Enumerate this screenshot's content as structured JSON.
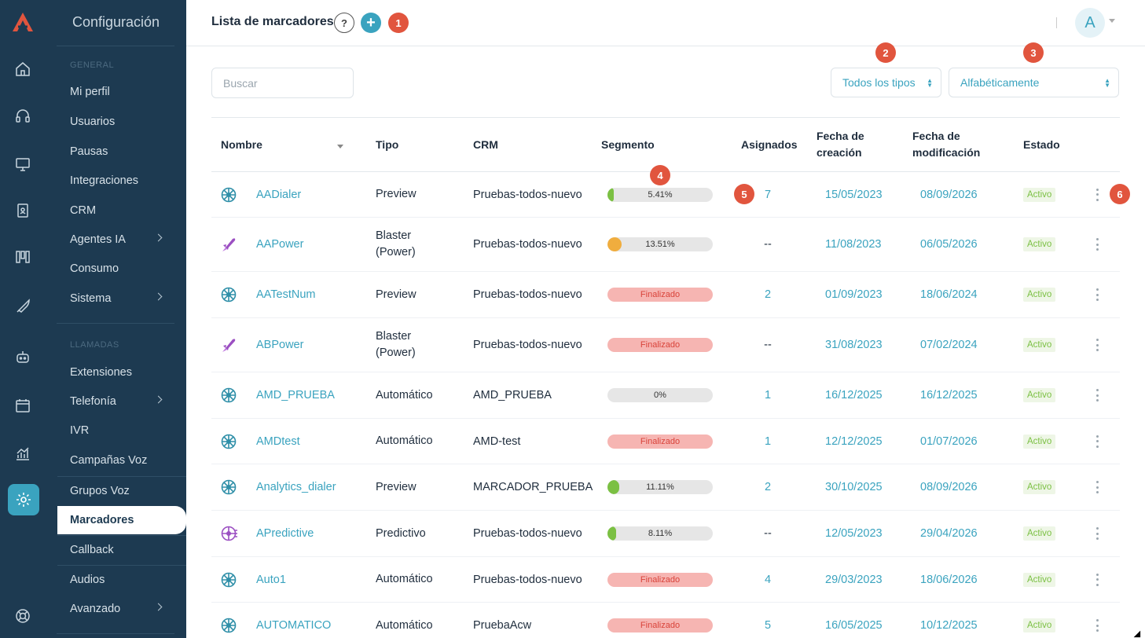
{
  "nav": {
    "title": "Configuración",
    "sections": {
      "general": "GENERAL",
      "calls": "LLAMADAS"
    },
    "items": [
      {
        "label": "Mi perfil"
      },
      {
        "label": "Usuarios"
      },
      {
        "label": "Pausas"
      },
      {
        "label": "Integraciones"
      },
      {
        "label": "CRM"
      },
      {
        "label": "Agentes IA"
      },
      {
        "label": "Consumo"
      },
      {
        "label": "Sistema"
      },
      {
        "label": "Extensiones"
      },
      {
        "label": "Telefonía"
      },
      {
        "label": "IVR"
      },
      {
        "label": "Campañas Voz"
      },
      {
        "label": "Grupos Voz"
      },
      {
        "label": "Marcadores"
      },
      {
        "label": "Callback"
      },
      {
        "label": "Audios"
      },
      {
        "label": "Avanzado"
      }
    ]
  },
  "header": {
    "title": "Lista de marcadores",
    "help": "?",
    "add": "+",
    "avatar": "A"
  },
  "tour_badges": [
    "1",
    "2",
    "3",
    "4",
    "5",
    "6"
  ],
  "filters": {
    "search_placeholder": "Buscar",
    "type": "Todos los tipos",
    "sort": "Alfabéticamente"
  },
  "table": {
    "headers": {
      "name": "Nombre",
      "type": "Tipo",
      "crm": "CRM",
      "segment": "Segmento",
      "assigned": "Asignados",
      "created_1": "Fecha de",
      "created_2": "creación",
      "modified_1": "Fecha de",
      "modified_2": "modificación",
      "status": "Estado"
    },
    "rows": [
      {
        "name": "AADialer",
        "icon": "wheel-icon",
        "type": "Preview",
        "crm": "Pruebas-todos-nuevo",
        "segment": "5.41%",
        "progress": 5.41,
        "assigned": "7",
        "created": "15/05/2023",
        "modified": "08/09/2026",
        "status": "Activo"
      },
      {
        "name": "AAPower",
        "icon": "rocket-icon",
        "type": "Blaster (Power)",
        "crm": "Pruebas-todos-nuevo",
        "segment": "13.51%",
        "progress": 13.51,
        "assigned": "--",
        "created": "11/08/2023",
        "modified": "06/05/2026",
        "status": "Activo"
      },
      {
        "name": "AATestNum",
        "icon": "wheel-icon",
        "type": "Preview",
        "crm": "Pruebas-todos-nuevo",
        "segment": "Finalizado",
        "progress": 0,
        "assigned": "2",
        "created": "01/09/2023",
        "modified": "18/06/2024",
        "status": "Activo"
      },
      {
        "name": "ABPower",
        "icon": "rocket-icon",
        "type": "Blaster (Power)",
        "crm": "Pruebas-todos-nuevo",
        "segment": "Finalizado",
        "progress": 40,
        "assigned": "--",
        "created": "31/08/2023",
        "modified": "07/02/2024",
        "status": "Activo"
      },
      {
        "name": "AMD_PRUEBA",
        "icon": "wheel-icon",
        "type": "Automático",
        "crm": "AMD_PRUEBA",
        "segment": "0%",
        "progress": 0,
        "assigned": "1",
        "created": "16/12/2025",
        "modified": "16/12/2025",
        "status": "Activo"
      },
      {
        "name": "AMDtest",
        "icon": "wheel-icon",
        "type": "Automático",
        "crm": "AMD-test",
        "segment": "Finalizado",
        "progress": 100,
        "assigned": "1",
        "created": "12/12/2025",
        "modified": "01/07/2026",
        "status": "Activo"
      },
      {
        "name": "Analytics_dialer",
        "icon": "wheel-icon",
        "type": "Preview",
        "crm": "MARCADOR_PRUEBA",
        "segment": "11.11%",
        "progress": 11.11,
        "assigned": "2",
        "created": "30/10/2025",
        "modified": "08/09/2026",
        "status": "Activo"
      },
      {
        "name": "APredictive",
        "icon": "predictive-wheel-icon",
        "type": "Predictivo",
        "crm": "Pruebas-todos-nuevo",
        "segment": "8.11%",
        "progress": 8.11,
        "assigned": "--",
        "created": "12/05/2023",
        "modified": "29/04/2026",
        "status": "Activo"
      },
      {
        "name": "Auto1",
        "icon": "wheel-icon",
        "type": "Automático",
        "crm": "Pruebas-todos-nuevo",
        "segment": "Finalizado",
        "progress": 100,
        "assigned": "4",
        "created": "29/03/2023",
        "modified": "18/06/2026",
        "status": "Activo"
      },
      {
        "name": "AUTOMATICO",
        "icon": "wheel-icon",
        "type": "Automático",
        "crm": "PruebaAcw",
        "segment": "Finalizado",
        "progress": 100,
        "assigned": "5",
        "created": "16/05/2025",
        "modified": "10/12/2025",
        "status": "Activo"
      }
    ]
  },
  "colors": {
    "accent": "#3aa3bf",
    "sidebar": "#1d3a51",
    "badge": "#e1553e",
    "active_status": "#7bc043",
    "finished": "#f6b5b2"
  }
}
